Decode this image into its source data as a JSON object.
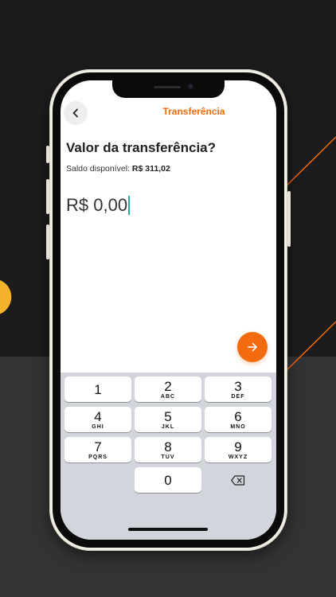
{
  "nav": {
    "title": "Transferência"
  },
  "prompt": {
    "question": "Valor da transferência?",
    "balance_label": "Saldo disponível:",
    "balance_value": "R$ 311,02",
    "amount": "R$ 0,00"
  },
  "keypad": {
    "keys": [
      {
        "num": "1",
        "letters": ""
      },
      {
        "num": "2",
        "letters": "ABC"
      },
      {
        "num": "3",
        "letters": "DEF"
      },
      {
        "num": "4",
        "letters": "GHI"
      },
      {
        "num": "5",
        "letters": "JKL"
      },
      {
        "num": "6",
        "letters": "MNO"
      },
      {
        "num": "7",
        "letters": "PQRS"
      },
      {
        "num": "8",
        "letters": "TUV"
      },
      {
        "num": "9",
        "letters": "WXYZ"
      },
      {
        "num": "0",
        "letters": ""
      }
    ]
  },
  "icons": {
    "back": "chevron-left-icon",
    "next": "arrow-right-icon",
    "delete": "backspace-icon"
  },
  "colors": {
    "accent": "#f26b0f",
    "cursor": "#1bb5a5",
    "keyboard_bg": "#d2d5db"
  }
}
